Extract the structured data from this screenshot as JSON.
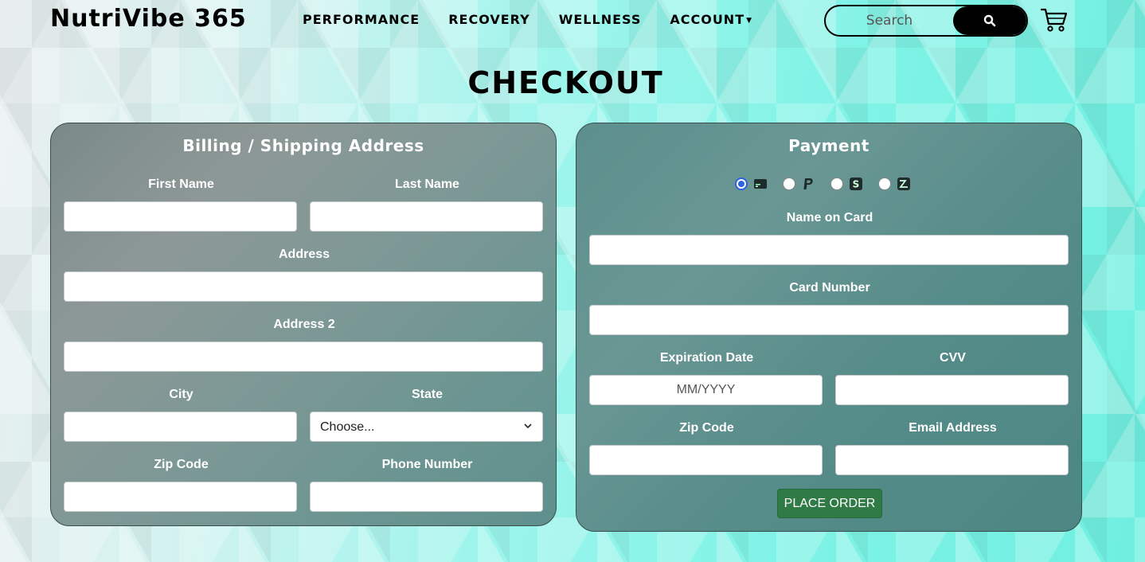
{
  "header": {
    "brand": "NutriVibe 365",
    "nav": [
      "PERFORMANCE",
      "RECOVERY",
      "WELLNESS",
      "ACCOUNT"
    ],
    "search_placeholder": "Search",
    "search_icon": "search-icon",
    "cart_icon": "cart-icon"
  },
  "page": {
    "title": "CHECKOUT"
  },
  "billing": {
    "title": "Billing / Shipping Address",
    "first_name_label": "First Name",
    "last_name_label": "Last Name",
    "address_label": "Address",
    "address2_label": "Address 2",
    "city_label": "City",
    "state_label": "State",
    "state_value": "Choose...",
    "zip_label": "Zip Code",
    "phone_label": "Phone Number"
  },
  "payment": {
    "title": "Payment",
    "methods": [
      {
        "icon": "credit-card-icon",
        "selected": true
      },
      {
        "icon": "paypal-icon",
        "selected": false
      },
      {
        "icon": "square-cash-icon",
        "selected": false
      },
      {
        "icon": "afterpay-icon",
        "selected": false
      }
    ],
    "name_label": "Name on Card",
    "card_label": "Card Number",
    "exp_label": "Expiration Date",
    "exp_placeholder": "MM/YYYY",
    "cvv_label": "CVV",
    "zip_label": "Zip Code",
    "email_label": "Email Address",
    "submit_label": "PLACE ORDER"
  },
  "colors": {
    "accent_button": "#2f7a45",
    "radio_selected": "#2f62e0"
  }
}
